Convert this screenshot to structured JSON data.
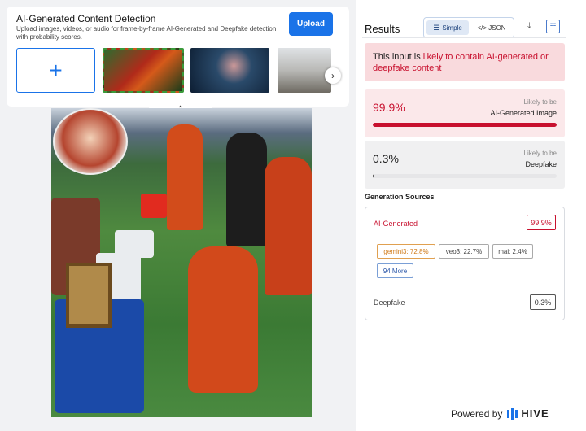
{
  "left_panel": {
    "title": "AI-Generated Content Detection",
    "subtitle": "Upload images, videos, or audio for frame-by-frame AI-Generated and Deepfake detection with probability scores.",
    "upload_label": "Upload",
    "add_icon": "plus-icon",
    "next_icon": "chevron-right-icon",
    "collapse_icon": "chevron-up-icon"
  },
  "results": {
    "title": "Results",
    "mode_simple": "Simple",
    "mode_json": "</> JSON",
    "alert_prefix": "This input is ",
    "alert_highlight": "likely to contain AI-generated or deepfake content",
    "scores": [
      {
        "pct": "99.9%",
        "likely": "Likely to be",
        "name": "AI-Generated Image",
        "fill": 0.999
      },
      {
        "pct": "0.3%",
        "likely": "Likely to be",
        "name": "Deepfake",
        "fill": 0.003
      }
    ],
    "sources_title": "Generation Sources",
    "sources": {
      "ai_label": "AI-Generated",
      "ai_value": "99.9%",
      "chips": [
        "gemini3: 72.8%",
        "veo3: 22.7%",
        "mai: 2.4%"
      ],
      "more": "94 More",
      "deepfake_label": "Deepfake",
      "deepfake_value": "0.3%"
    }
  },
  "footer": {
    "powered_by": "Powered by",
    "brand": "HIVE"
  },
  "colors": {
    "accent": "#1a73e8",
    "danger": "#c8102e",
    "alert_bg": "#f9dadd"
  }
}
